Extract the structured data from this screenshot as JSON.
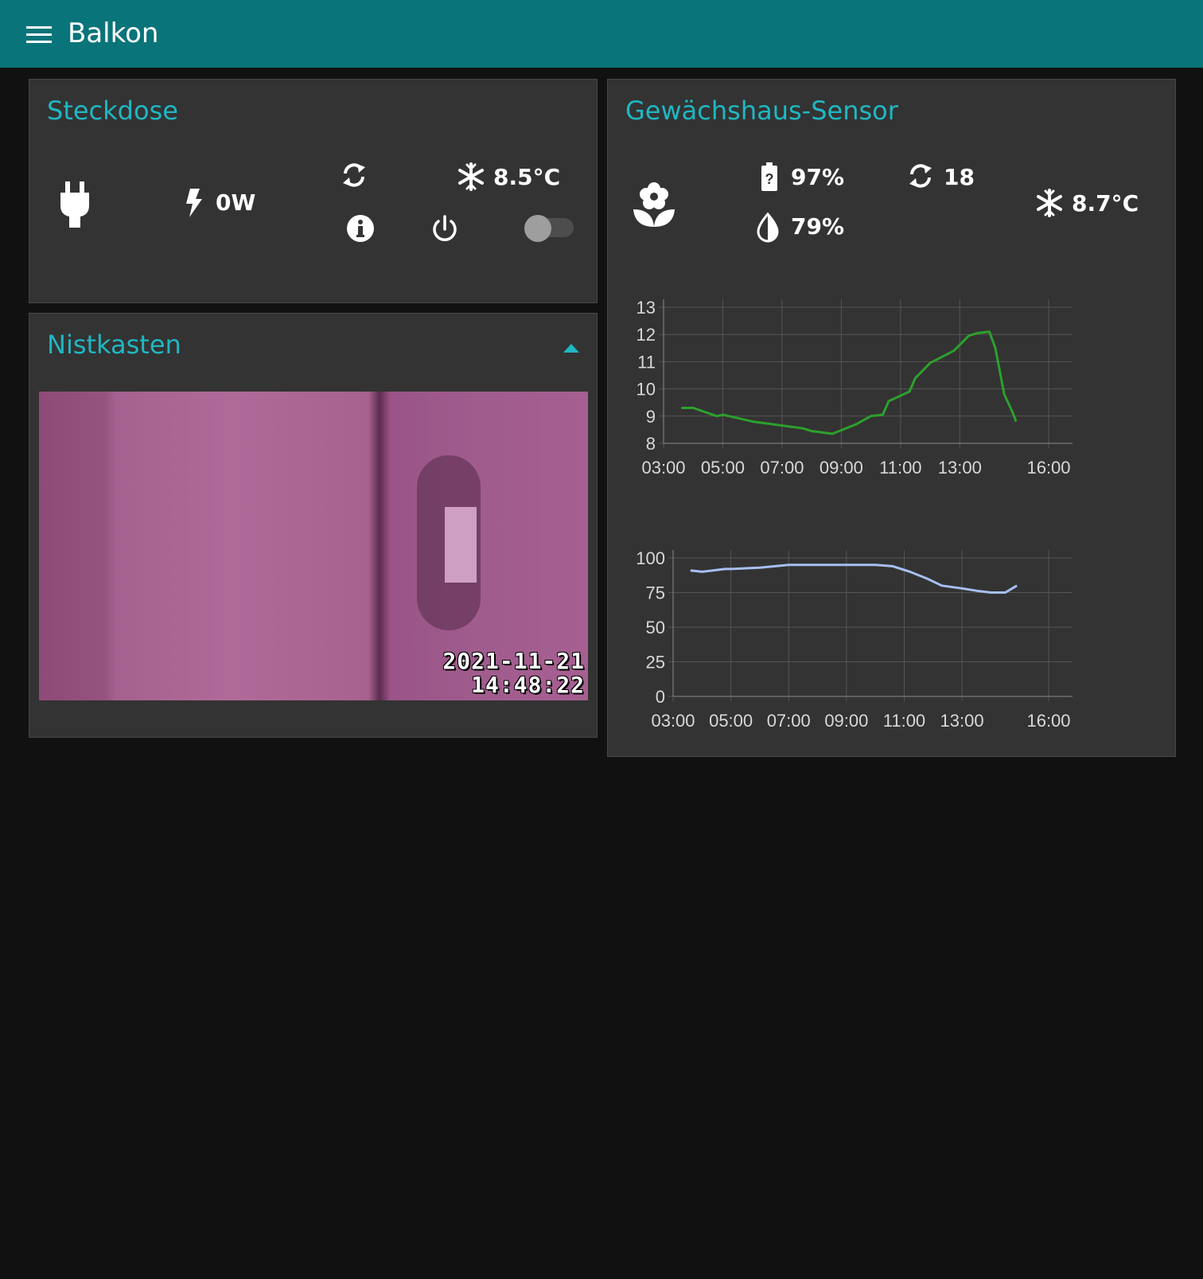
{
  "header": {
    "title": "Balkon",
    "menu_icon": "menu-icon"
  },
  "steckdose": {
    "title": "Steckdose",
    "power": "0W",
    "temperature": "8.5°C",
    "switch_on": false,
    "icons": [
      "plug-icon",
      "bolt-icon",
      "refresh-icon",
      "snowflake-icon",
      "info-icon",
      "power-icon"
    ]
  },
  "nistkasten": {
    "title": "Nistkasten",
    "timestamp_date": "2021-11-21",
    "timestamp_time": "14:48:22"
  },
  "sensor": {
    "title": "Gewächshaus-Sensor",
    "battery": "97%",
    "updates": "18",
    "humidity": "79%",
    "temperature": "8.7°C",
    "icons": [
      "flower-icon",
      "battery-icon",
      "refresh-icon",
      "humidity-icon",
      "snowflake-icon"
    ]
  },
  "chart_data": [
    {
      "type": "line",
      "ylim": [
        8,
        13
      ],
      "y_ticks": [
        "13",
        "12",
        "11",
        "10",
        "9",
        "8"
      ],
      "x_ticks": [
        "03:00",
        "05:00",
        "07:00",
        "09:00",
        "11:00",
        "13:00",
        "16:00"
      ],
      "color": "#2ca02c",
      "x": [
        3.6,
        4.0,
        4.8,
        5.0,
        6.0,
        7.7,
        8.0,
        8.7,
        9.5,
        10.0,
        10.4,
        10.6,
        11.3,
        11.5,
        12.0,
        12.8,
        13.3,
        13.6,
        14.0,
        14.2,
        14.5,
        14.8,
        14.9
      ],
      "y": [
        9.3,
        9.3,
        9.0,
        9.05,
        8.8,
        8.55,
        8.45,
        8.35,
        8.7,
        9.0,
        9.05,
        9.55,
        9.9,
        10.4,
        10.95,
        11.4,
        11.95,
        12.05,
        12.1,
        11.5,
        9.8,
        9.1,
        8.8
      ]
    },
    {
      "type": "line",
      "ylim": [
        0,
        100
      ],
      "y_ticks": [
        "100",
        "75",
        "50",
        "25",
        "0"
      ],
      "x_ticks": [
        "03:00",
        "05:00",
        "07:00",
        "09:00",
        "11:00",
        "13:00",
        "16:00"
      ],
      "color": "#a7bff2",
      "x": [
        3.6,
        4.0,
        4.8,
        5.0,
        6.0,
        7.0,
        8.0,
        9.0,
        10.0,
        10.6,
        11.2,
        11.8,
        12.3,
        13.0,
        13.6,
        14.0,
        14.5,
        14.9
      ],
      "y": [
        91,
        90,
        92,
        92,
        93,
        95,
        95,
        95,
        95,
        94,
        90,
        85,
        80,
        78,
        76,
        75,
        75,
        80
      ]
    }
  ]
}
